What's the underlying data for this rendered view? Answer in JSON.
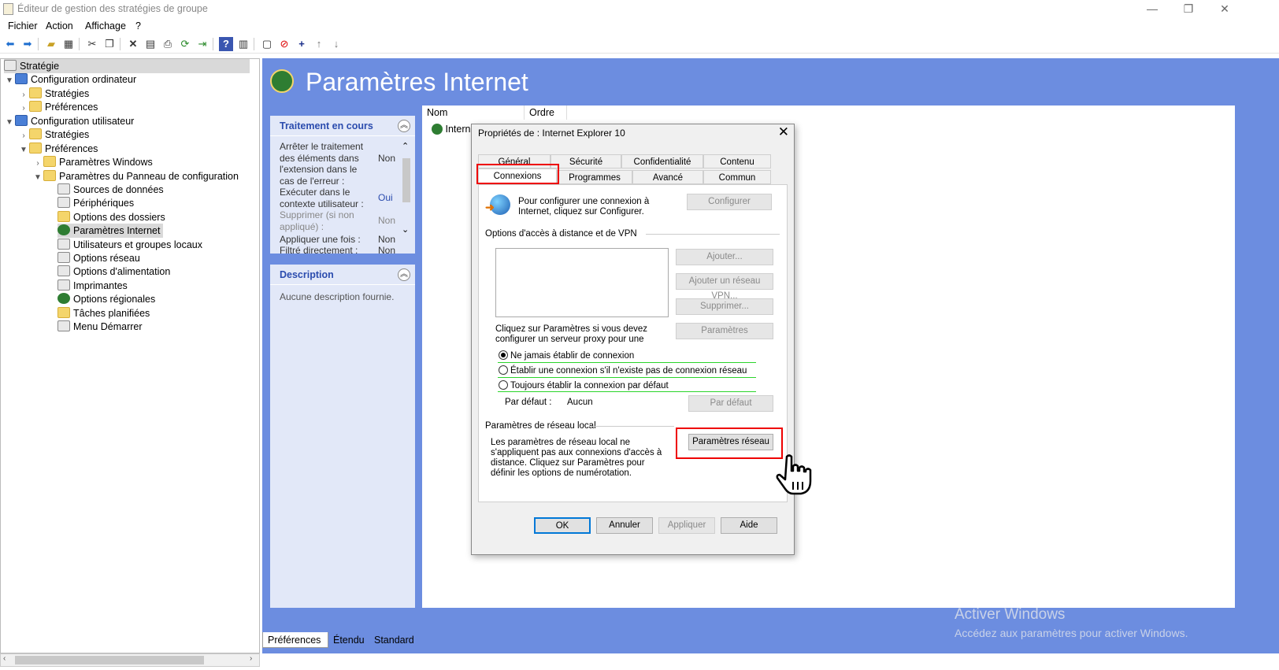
{
  "window": {
    "title": "Éditeur de gestion des stratégies de groupe",
    "minimize": "—",
    "restore": "❐",
    "close": "✕"
  },
  "menu": [
    "Fichier",
    "Action",
    "Affichage",
    "?"
  ],
  "toolbar_icons": [
    "back-icon",
    "forward-icon",
    "folder-up-icon",
    "show-tree-icon",
    "cut-icon",
    "copy-icon",
    "delete-icon",
    "properties-icon",
    "print-icon",
    "refresh-icon",
    "export-icon",
    "help-icon",
    "view-icon",
    "new-icon",
    "disable-icon",
    "add-icon",
    "up-icon",
    "down-icon"
  ],
  "tree": {
    "root": "Stratégie",
    "items": [
      {
        "label": "Configuration ordinateur"
      },
      {
        "label": "Stratégies"
      },
      {
        "label": "Préférences"
      },
      {
        "label": "Configuration utilisateur"
      },
      {
        "label": "Stratégies"
      },
      {
        "label": "Préférences"
      },
      {
        "label": "Paramètres Windows"
      },
      {
        "label": "Paramètres du Panneau de configuration"
      },
      {
        "label": "Sources de données"
      },
      {
        "label": "Périphériques"
      },
      {
        "label": "Options des dossiers"
      },
      {
        "label": "Paramètres Internet"
      },
      {
        "label": "Utilisateurs et groupes locaux"
      },
      {
        "label": "Options réseau"
      },
      {
        "label": "Options d'alimentation"
      },
      {
        "label": "Imprimantes"
      },
      {
        "label": "Options régionales"
      },
      {
        "label": "Tâches planifiées"
      },
      {
        "label": "Menu Démarrer"
      }
    ]
  },
  "header": {
    "title": "Paramètres Internet"
  },
  "processing": {
    "title": "Traitement en cours",
    "rows": [
      {
        "label": "Arrêter le traitement des éléments dans l'extension dans le cas de l'erreur :",
        "value": "Non"
      },
      {
        "label": "Exécuter dans le contexte utilisateur :",
        "value": "Oui"
      },
      {
        "label": "Supprimer (si non appliqué) :",
        "value": "Non"
      },
      {
        "label": "Appliquer une fois :",
        "value": "Non"
      },
      {
        "label": "Filtré directement :",
        "value": "Non"
      }
    ]
  },
  "description": {
    "title": "Description",
    "text": "Aucune description fournie."
  },
  "list": {
    "col_name": "Nom",
    "col_order": "Ordre",
    "row": "Internet"
  },
  "bottom_tabs": [
    "Préférences",
    "Étendu",
    "Standard"
  ],
  "watermark": {
    "line1": "Activer Windows",
    "line2": "Accédez aux paramètres pour activer Windows."
  },
  "dialog": {
    "title": "Propriétés de : Internet Explorer 10",
    "tabs_row1": [
      "Général",
      "Sécurité",
      "Confidentialité",
      "Contenu"
    ],
    "tabs_row2": [
      "Connexions",
      "Programmes",
      "Avancé",
      "Commun"
    ],
    "setup_text": "Pour configurer une connexion à Internet, cliquez sur Configurer.",
    "btn_configure": "Configurer",
    "vpn_section": "Options d'accès à distance et de VPN",
    "btn_add": "Ajouter...",
    "btn_add_vpn": "Ajouter un réseau VPN...",
    "btn_remove": "Supprimer...",
    "btn_settings": "Paramètres",
    "proxy_text": "Cliquez sur Paramètres si vous devez configurer un serveur proxy pour une",
    "radios": [
      {
        "label": "Ne jamais établir de connexion",
        "checked": true
      },
      {
        "label": "Établir une connexion s'il n'existe pas de connexion réseau",
        "checked": false
      },
      {
        "label": "Toujours établir la connexion par défaut",
        "checked": false
      }
    ],
    "default_label": "Par défaut :",
    "default_value": "Aucun",
    "btn_default": "Par défaut",
    "lan_section": "Paramètres de réseau local",
    "lan_text": "Les paramètres de réseau local ne s'appliquent pas aux connexions d'accès à distance. Cliquez sur Paramètres pour définir les options de numérotation.",
    "btn_lan": "Paramètres réseau",
    "btn_ok": "OK",
    "btn_cancel": "Annuler",
    "btn_apply": "Appliquer",
    "btn_help": "Aide"
  },
  "colors": {
    "accent": "#6c8de0",
    "highlight": "#e00000",
    "panel_title": "#2b4cae"
  }
}
